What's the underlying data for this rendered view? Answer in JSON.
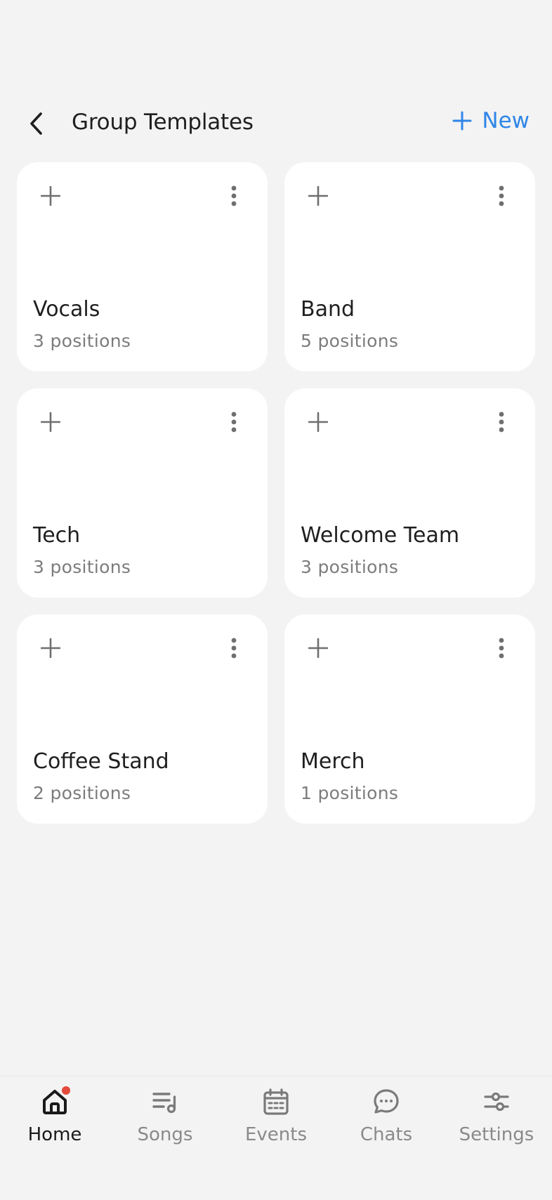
{
  "header": {
    "title": "Group Templates",
    "new_label": "New",
    "back_icon": "chevron-left-icon",
    "new_icon": "plus-icon"
  },
  "colors": {
    "accent": "#2f86e8",
    "background": "#f3f3f3",
    "card": "#ffffff",
    "notification": "#e24a3b"
  },
  "groups": [
    {
      "name": "Vocals",
      "count": "3 positions"
    },
    {
      "name": "Band",
      "count": "5 positions"
    },
    {
      "name": "Tech",
      "count": "3 positions"
    },
    {
      "name": "Welcome Team",
      "count": "3 positions"
    },
    {
      "name": "Coffee Stand",
      "count": "2 positions"
    },
    {
      "name": "Merch",
      "count": "1 positions"
    }
  ],
  "nav": {
    "items": [
      {
        "label": "Home",
        "icon": "home-icon",
        "active": true,
        "notification": true
      },
      {
        "label": "Songs",
        "icon": "music-list-icon",
        "active": false
      },
      {
        "label": "Events",
        "icon": "calendar-icon",
        "active": false
      },
      {
        "label": "Chats",
        "icon": "chat-bubble-icon",
        "active": false
      },
      {
        "label": "Settings",
        "icon": "sliders-icon",
        "active": false
      }
    ]
  }
}
